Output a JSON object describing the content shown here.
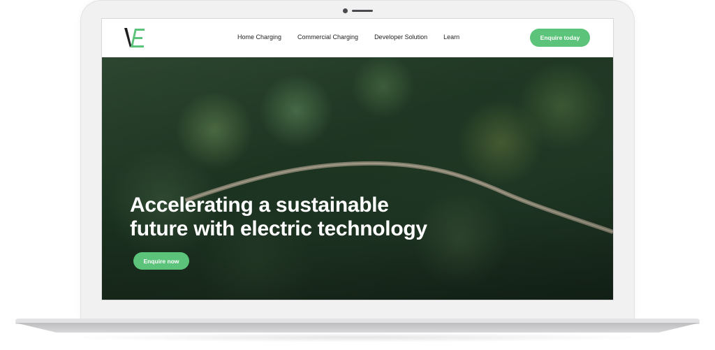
{
  "logo": {
    "text": "VE"
  },
  "nav": {
    "items": [
      {
        "label": "Home Charging"
      },
      {
        "label": "Commercial Charging"
      },
      {
        "label": "Developer Solution"
      },
      {
        "label": "Learn"
      }
    ],
    "cta_label": "Enquire today"
  },
  "hero": {
    "title_line1": "Accelerating a sustainable",
    "title_line2": "future with electric technology",
    "cta_label": "Enquire now"
  },
  "colors": {
    "accent": "#5cc37a",
    "logo_dark": "#1e1e1e",
    "forest": "#1f3824"
  },
  "icons": [
    "camera-icon",
    "logo-mark"
  ]
}
